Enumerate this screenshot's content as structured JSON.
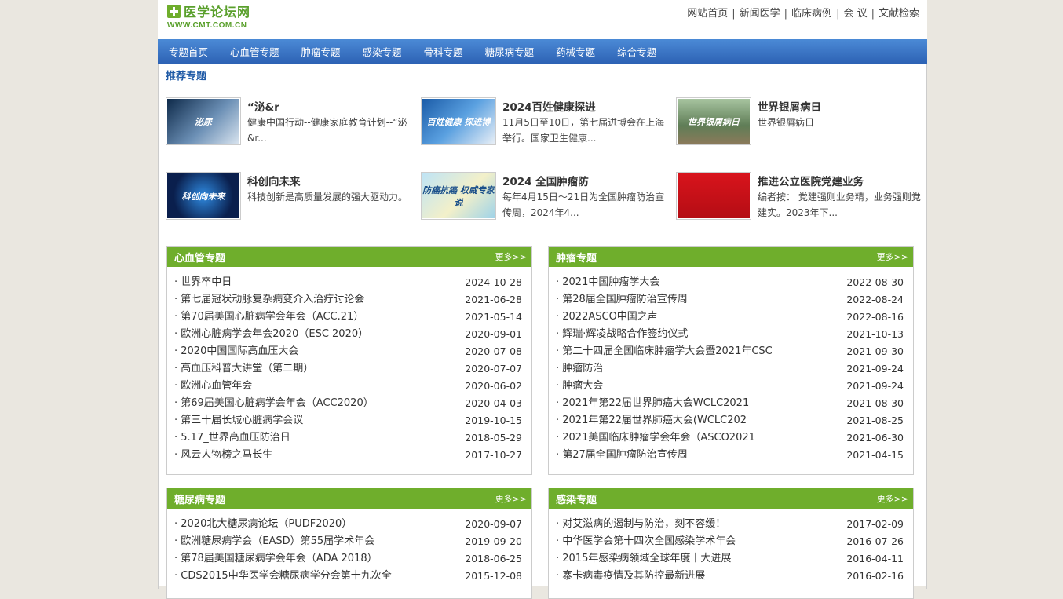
{
  "header": {
    "logo_name": "医学论坛网",
    "logo_url": "WWW.CMT.COM.CN",
    "links": [
      "网站首页",
      "新闻医学",
      "临床病例",
      "会 议",
      "文献检索"
    ]
  },
  "nav": [
    "专题首页",
    "心血管专题",
    "肿瘤专题",
    "感染专题",
    "骨科专题",
    "糖尿病专题",
    "药械专题",
    "综合专题"
  ],
  "recommend": {
    "title": "推荐专题",
    "items": [
      {
        "title": "“泌&r",
        "desc": "健康中国行动--健康家庭教育计划--“泌&r...",
        "thumb_text": "泌尿"
      },
      {
        "title": "2024百姓健康探进",
        "desc": "11月5日至10日，第七届进博会在上海举行。国家卫生健康...",
        "thumb_text": "百姓健康 探进博"
      },
      {
        "title": "世界银屑病日",
        "desc": "世界银屑病日",
        "thumb_text": "世界银屑病日"
      },
      {
        "title": "科创向未来",
        "desc": "科技创新是高质量发展的强大驱动力。",
        "thumb_text": "科创向未来"
      },
      {
        "title": "2024 全国肿瘤防",
        "desc": "每年4月15日～21日为全国肿瘤防治宣传周，2024年4...",
        "thumb_text": "防癌抗癌 权威专家说"
      },
      {
        "title": "推进公立医院党建业务",
        "desc": "编者按： 党建强则业务精，业务强则党建实。2023年下...",
        "thumb_text": ""
      }
    ]
  },
  "more_label": "更多>>",
  "boxes": [
    {
      "title": "心血管专题",
      "items": [
        {
          "t": "世界卒中日",
          "d": "2024-10-28"
        },
        {
          "t": "第七届冠状动脉复杂病变介入治疗讨论会",
          "d": "2021-06-28"
        },
        {
          "t": "第70届美国心脏病学会年会（ACC.21）",
          "d": "2021-05-14"
        },
        {
          "t": "欧洲心脏病学会年会2020（ESC 2020）",
          "d": "2020-09-01"
        },
        {
          "t": "2020中国国际高血压大会",
          "d": "2020-07-08"
        },
        {
          "t": "高血压科普大讲堂（第二期）",
          "d": "2020-07-07"
        },
        {
          "t": "欧洲心血管年会",
          "d": "2020-06-02"
        },
        {
          "t": "第69届美国心脏病学会年会（ACC2020）",
          "d": "2020-04-03"
        },
        {
          "t": "第三十届长城心脏病学会议",
          "d": "2019-10-15"
        },
        {
          "t": "5.17_世界高血压防治日",
          "d": "2018-05-29"
        },
        {
          "t": "风云人物榜之马长生",
          "d": "2017-10-27"
        }
      ]
    },
    {
      "title": "肿瘤专题",
      "items": [
        {
          "t": "2021中国肿瘤学大会",
          "d": "2022-08-30"
        },
        {
          "t": "第28届全国肿瘤防治宣传周",
          "d": "2022-08-24"
        },
        {
          "t": "2022ASCO中国之声",
          "d": "2022-08-16"
        },
        {
          "t": "辉瑞·辉凌战略合作签约仪式",
          "d": "2021-10-13"
        },
        {
          "t": "第二十四届全国临床肿瘤学大会暨2021年CSC",
          "d": "2021-09-30"
        },
        {
          "t": "肿瘤防治",
          "d": "2021-09-24"
        },
        {
          "t": "肿瘤大会",
          "d": "2021-09-24"
        },
        {
          "t": "2021年第22届世界肺癌大会WCLC2021",
          "d": "2021-08-30"
        },
        {
          "t": "2021年第22届世界肺癌大会(WCLC202",
          "d": "2021-08-25"
        },
        {
          "t": "2021美国临床肿瘤学会年会（ASCO2021",
          "d": "2021-06-30"
        },
        {
          "t": "第27届全国肿瘤防治宣传周",
          "d": "2021-04-15"
        }
      ]
    },
    {
      "title": "糖尿病专题",
      "items": [
        {
          "t": "2020北大糖尿病论坛（PUDF2020）",
          "d": "2020-09-07"
        },
        {
          "t": "欧洲糖尿病学会（EASD）第55届学术年会",
          "d": "2019-09-20"
        },
        {
          "t": "第78届美国糖尿病学会年会（ADA 2018）",
          "d": "2018-06-25"
        },
        {
          "t": "CDS2015中华医学会糖尿病学分会第十九次全",
          "d": "2015-12-08"
        }
      ]
    },
    {
      "title": "感染专题",
      "items": [
        {
          "t": "对艾滋病的遏制与防治，刻不容缓！",
          "d": "2017-02-09"
        },
        {
          "t": "中华医学会第十四次全国感染学术年会",
          "d": "2016-07-26"
        },
        {
          "t": "2015年感染病领域全球年度十大进展",
          "d": "2016-04-11"
        },
        {
          "t": "寨卡病毒疫情及其防控最新进展",
          "d": "2016-02-16"
        }
      ]
    }
  ]
}
